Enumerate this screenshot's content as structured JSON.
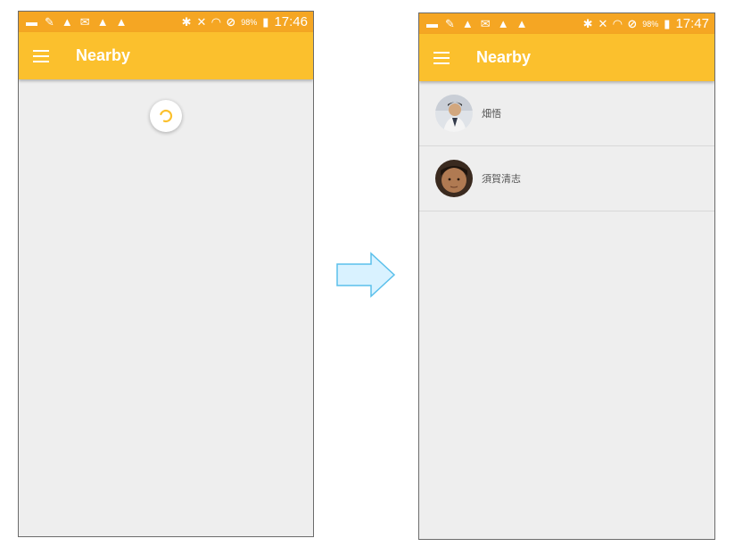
{
  "left_screen": {
    "status_bar": {
      "battery_percent": "98%",
      "time": "17:46",
      "left_icons": [
        "chat-icon",
        "wrench-icon",
        "warning-icon",
        "mail-icon",
        "warning-icon",
        "warning-icon"
      ],
      "right_icons": [
        "bluetooth-icon",
        "mute-icon",
        "wifi-icon",
        "blocked-icon",
        "battery-icon"
      ]
    },
    "app_bar": {
      "title": "Nearby"
    },
    "loading": true
  },
  "right_screen": {
    "status_bar": {
      "battery_percent": "98%",
      "time": "17:47"
    },
    "app_bar": {
      "title": "Nearby"
    },
    "users": [
      {
        "name": "畑悟"
      },
      {
        "name": "須賀清志"
      }
    ]
  },
  "colors": {
    "status_bar": "#f5a623",
    "app_bar": "#fbc02d",
    "background": "#eeeeee",
    "arrow_fill": "#d9f2ff",
    "arrow_stroke": "#5bc0eb"
  }
}
